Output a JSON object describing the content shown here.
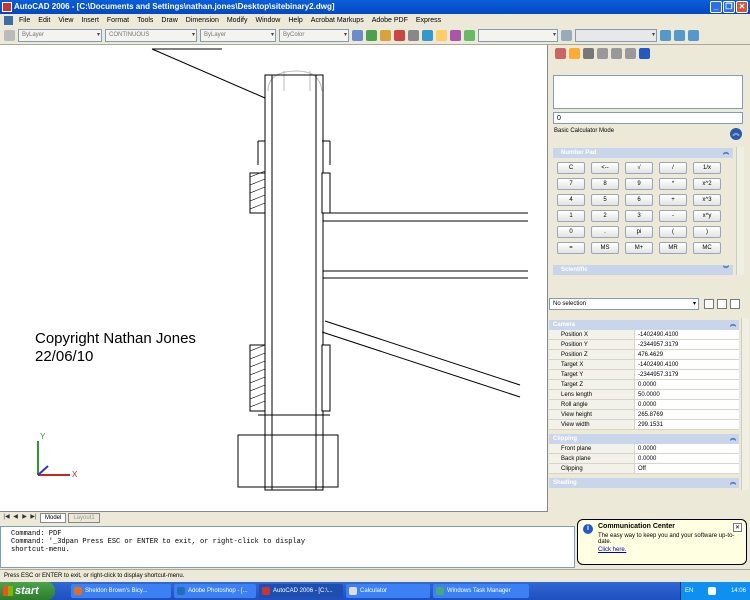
{
  "window": {
    "title": "AutoCAD 2006 - [C:\\Documents and Settings\\nathan.jones\\Desktop\\sitebinary2.dwg]"
  },
  "menu": [
    "File",
    "Edit",
    "View",
    "Insert",
    "Format",
    "Tools",
    "Draw",
    "Dimension",
    "Modify",
    "Window",
    "Help",
    "Acrobat Markups",
    "Adobe PDF",
    "Express"
  ],
  "toolbar": {
    "layer": "ByLayer",
    "linetype": "CONTINUOUS",
    "lineweight": "ByLayer",
    "plotstyle": "ByColor"
  },
  "drawing": {
    "copyright_line1": "Copyright Nathan Jones",
    "copyright_line2": "22/06/10",
    "ucs_y": "Y",
    "ucs_x": "X"
  },
  "tabs": {
    "model": "Model",
    "layout": "Layout1"
  },
  "command": {
    "lines": [
      "Command: PDF",
      "Command: '_3dpan Press ESC or ENTER to exit, or right-click to display",
      "shortcut-menu."
    ]
  },
  "status": "Press ESC or ENTER to exit, or right-click to display shortcut-menu.",
  "calculator": {
    "input_value": "0",
    "mode_label": "Basic Calculator Mode",
    "number_pad_title": "Number Pad",
    "scientific_title": "Scientific",
    "keys": [
      "C",
      "<--",
      "√",
      "/",
      "1/x",
      "7",
      "8",
      "9",
      "*",
      "x^2",
      "4",
      "5",
      "6",
      "+",
      "x^3",
      "1",
      "2",
      "3",
      "-",
      "x^y",
      "0",
      ".",
      "pi",
      "(",
      ")",
      "=",
      "MS",
      "M+",
      "MR",
      "MC"
    ]
  },
  "properties": {
    "selection": "No selection",
    "groups": {
      "camera": "Camera",
      "clipping": "Clipping",
      "shading": "Shading"
    },
    "camera": [
      {
        "name": "Position X",
        "value": "-1402490.4100"
      },
      {
        "name": "Position Y",
        "value": "-2344957.3179"
      },
      {
        "name": "Position Z",
        "value": "476.4629"
      },
      {
        "name": "Target X",
        "value": "-1402490.4100"
      },
      {
        "name": "Target Y",
        "value": "-2344957.3179"
      },
      {
        "name": "Target Z",
        "value": "0.0000"
      },
      {
        "name": "Lens length",
        "value": "50.0000"
      },
      {
        "name": "Roll angle",
        "value": "0.0000"
      },
      {
        "name": "View height",
        "value": "265.8769"
      },
      {
        "name": "View width",
        "value": "299.1531"
      }
    ],
    "clipping": [
      {
        "name": "Front plane",
        "value": "0.0000"
      },
      {
        "name": "Back plane",
        "value": "0.0000"
      },
      {
        "name": "Clipping",
        "value": "Off"
      }
    ]
  },
  "balloon": {
    "title": "Communication Center",
    "text": "The easy way to keep you and your software up-to-date.",
    "link": "Click here."
  },
  "taskbar": {
    "start": "start",
    "tasks": [
      "Sheldon Brown's Bicy...",
      "Adobe Photoshop - [...",
      "AutoCAD 2006 - [C:\\...",
      "Calculator",
      "Windows Task Manager"
    ],
    "lang": "EN",
    "clock": "14:06"
  },
  "colors": {
    "titlebar": "#0a5fd8",
    "taskbar": "#3168d5",
    "start": "#2c7d2c"
  }
}
